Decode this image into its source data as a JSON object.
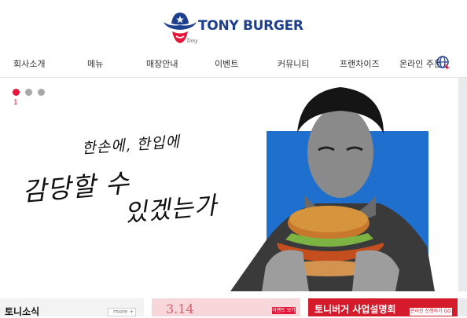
{
  "brand": {
    "name": "TONY BURGER",
    "logo_icon": "cowboy-hat-logo-icon"
  },
  "nav": {
    "items": [
      {
        "label": "회사소개"
      },
      {
        "label": "메뉴"
      },
      {
        "label": "매장안내"
      },
      {
        "label": "이벤트"
      },
      {
        "label": "커뮤니티"
      },
      {
        "label": "프랜차이즈"
      },
      {
        "label": "온라인 주문"
      }
    ],
    "order_icon": "globe-cursor-icon"
  },
  "hero": {
    "slide_current": "1",
    "copy_line1": "한손에, 한입에",
    "copy_line2": "감당할 수",
    "copy_line3": "있겠는가",
    "accent_color": "#e5173c",
    "panel_color": "#1f6fcf"
  },
  "news": {
    "title": "토니소식",
    "more_label": "more +"
  },
  "event": {
    "date": "3.14",
    "tag": "이벤트 보기"
  },
  "briefing": {
    "title": "토니버거 사업설명회",
    "button": "온라인 신청하기 GO"
  }
}
